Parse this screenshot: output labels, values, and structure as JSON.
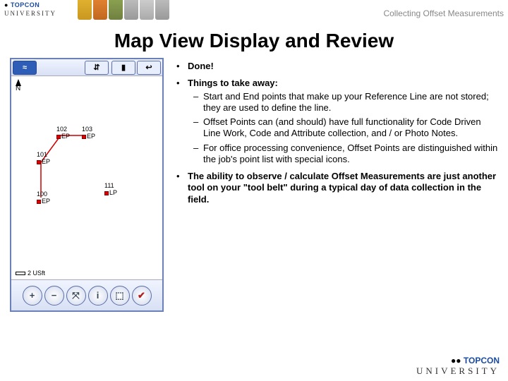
{
  "header": {
    "brand": "TOPCON",
    "brand_sub": "UNIVERSITY",
    "section": "Collecting Offset Measurements"
  },
  "title": "Map View Display and Review",
  "device": {
    "topbar": {
      "icon1": "⇵",
      "icon2": "▮",
      "back": "↩"
    },
    "north": "N",
    "points": {
      "p102": {
        "id": "102",
        "code": "EP"
      },
      "p103": {
        "id": "103",
        "code": "EP"
      },
      "p101": {
        "id": "101",
        "code": "EP"
      },
      "p100": {
        "id": "100",
        "code": "EP"
      },
      "p111": {
        "id": "111",
        "code": "LP"
      }
    },
    "scale": "2 USft",
    "buttons": {
      "zoom_in": "+",
      "zoom_out": "−",
      "fit": "⤧",
      "info": "i",
      "layers": "⬚",
      "check": "✔"
    }
  },
  "bullets": {
    "b1": "Done!",
    "b2": "Things to take away:",
    "b2_sub": {
      "s1": "Start and End points that make up your Reference Line are not stored; they are used to define the line.",
      "s2": "Offset Points can (and should) have full functionality for Code Driven Line Work, Code and Attribute collection, and / or Photo Notes.",
      "s3": "For office processing convenience, Offset Points are distinguished within the job's point list with special icons."
    },
    "b3": "The ability to observe / calculate Offset Measurements are just another tool on your \"tool belt\" during a typical day of data collection in the field."
  },
  "footer": {
    "brand": "TOPCON",
    "uni": "UNIVERSITY"
  }
}
